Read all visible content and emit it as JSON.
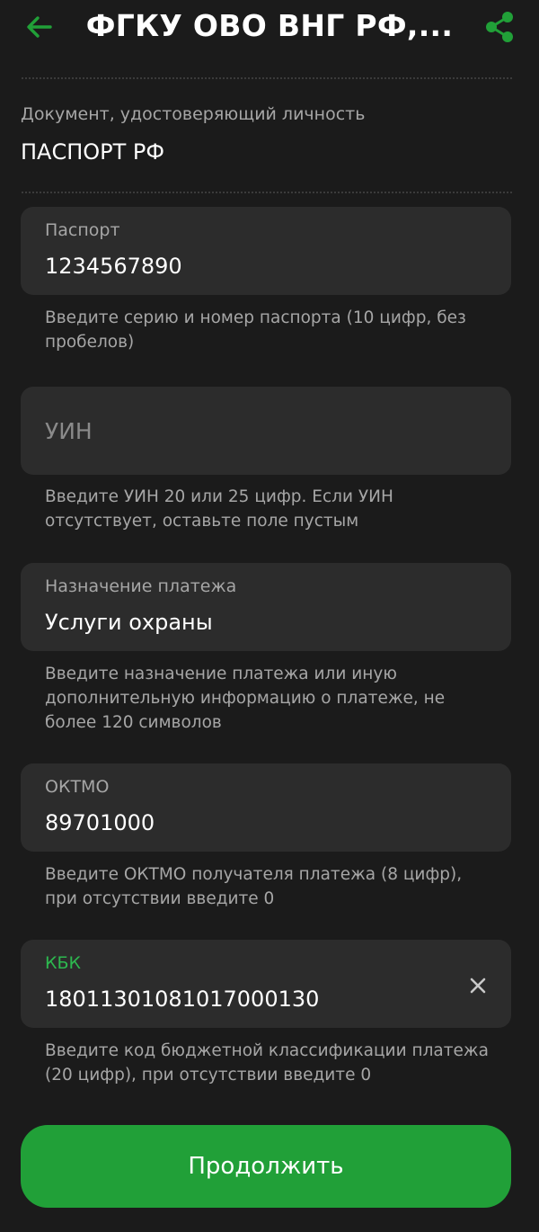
{
  "header": {
    "title": "ФГКУ ОВО ВНГ РФ,...",
    "back_icon": "arrow-left-icon",
    "share_icon": "share-icon",
    "accent_color": "#21a038"
  },
  "document": {
    "label": "Документ, удостоверяющий личность",
    "value": "ПАСПОРТ РФ"
  },
  "fields": {
    "passport": {
      "label": "Паспорт",
      "value": "1234567890",
      "hint": "Введите серию и номер паспорта (10 цифр, без пробелов)"
    },
    "uin": {
      "placeholder": "УИН",
      "hint": "Введите УИН 20 или 25 цифр. Если УИН отсутствует, оставьте поле пустым"
    },
    "purpose": {
      "label": "Назначение платежа",
      "value": "Услуги охраны",
      "hint": "Введите назначение платежа или иную дополнительную информацию о платеже, не более 120 символов"
    },
    "oktmo": {
      "label": "ОКТМО",
      "value": "89701000",
      "hint": "Введите ОКТМО получателя платежа (8 цифр), при отсутствии введите 0"
    },
    "kbk": {
      "label": "КБК",
      "value": "18011301081017000130",
      "hint": "Введите код бюджетной классификации платежа (20 цифр), при отсутствии введите 0",
      "clear_icon": "close-icon"
    }
  },
  "actions": {
    "continue_label": "Продолжить"
  }
}
